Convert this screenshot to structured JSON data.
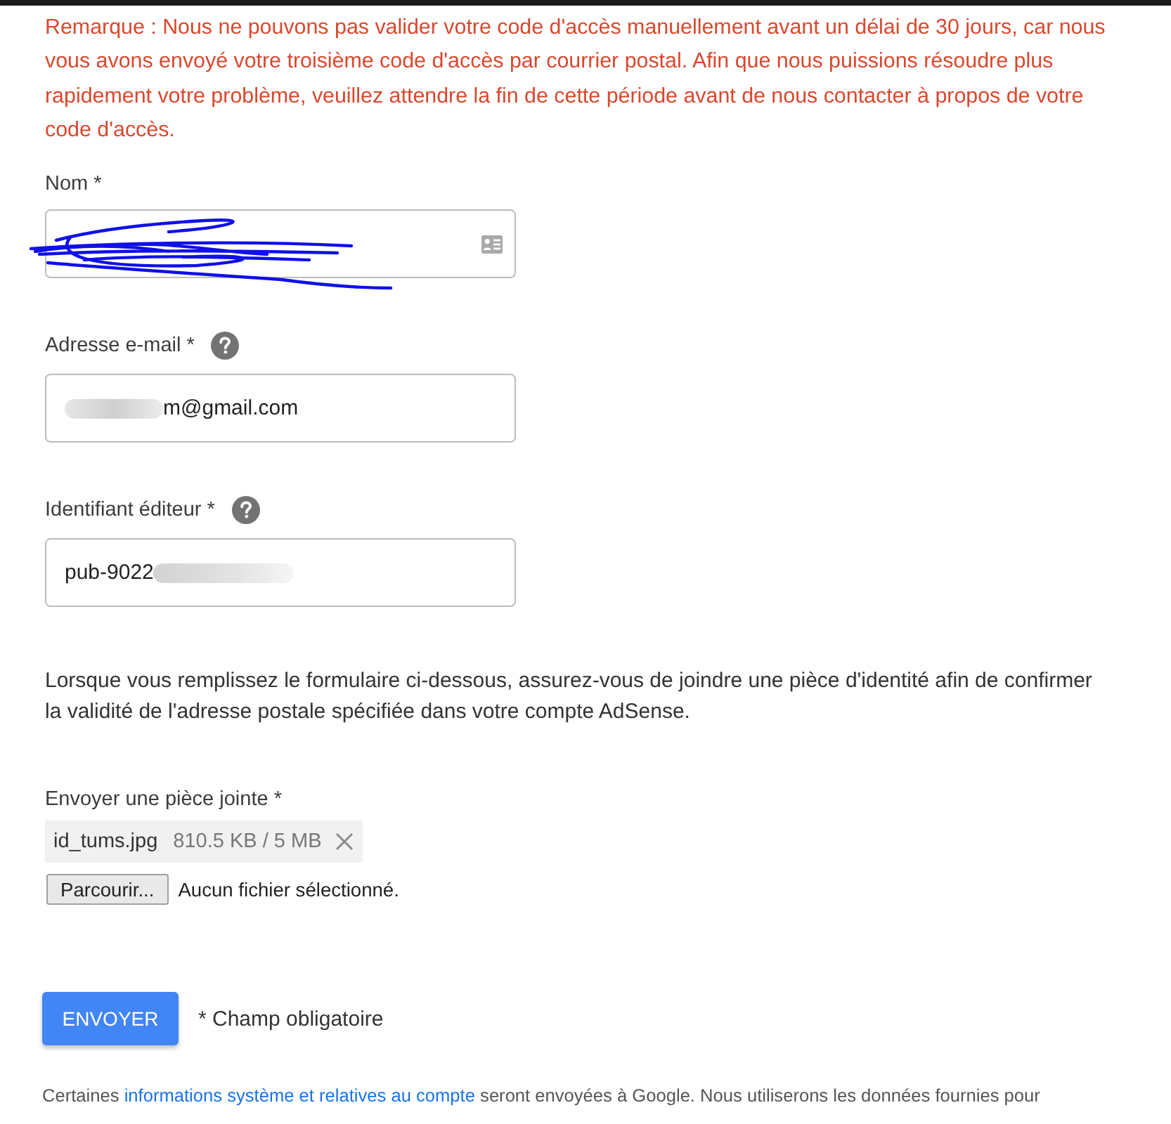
{
  "notice": "Remarque : Nous ne pouvons pas valider votre code d'accès manuellement avant un délai de 30 jours, car nous vous avons envoyé votre troisième code d'accès par courrier postal. Afin que nous puissions résoudre plus rapidement votre problème, veuillez attendre la fin de cette période avant de nous contacter à propos de votre code d'accès.",
  "fields": [
    {
      "kind": "scribbled",
      "label": "Nom *",
      "help": false,
      "autofill_icon": true
    },
    {
      "kind": "blurred_start",
      "label": "Adresse e-mail *",
      "help": true,
      "autofill_icon": false,
      "value": "m@gmail.com"
    },
    {
      "kind": "blurred_end",
      "label": "Identifiant éditeur *",
      "help": true,
      "autofill_icon": false,
      "value": "pub-9022"
    }
  ],
  "instructions": "Lorsque vous remplissez le formulaire ci-dessous, assurez-vous de joindre une pièce d'identité afin de confirmer la validité de l'adresse postale spécifiée dans votre compte AdSense.",
  "attachment": {
    "label": "Envoyer une pièce jointe *",
    "file": {
      "name": "id_tums.jpg",
      "size": "810.5 KB / 5 MB"
    },
    "browse_button": "Parcourir...",
    "status": "Aucun fichier sélectionné."
  },
  "submit": {
    "label": "ENVOYER",
    "note": "* Champ obligatoire"
  },
  "footer": {
    "before": "Certaines ",
    "link": "informations système et relatives au compte",
    "after": " seront envoyées à Google. Nous utiliserons les données fournies pour"
  }
}
